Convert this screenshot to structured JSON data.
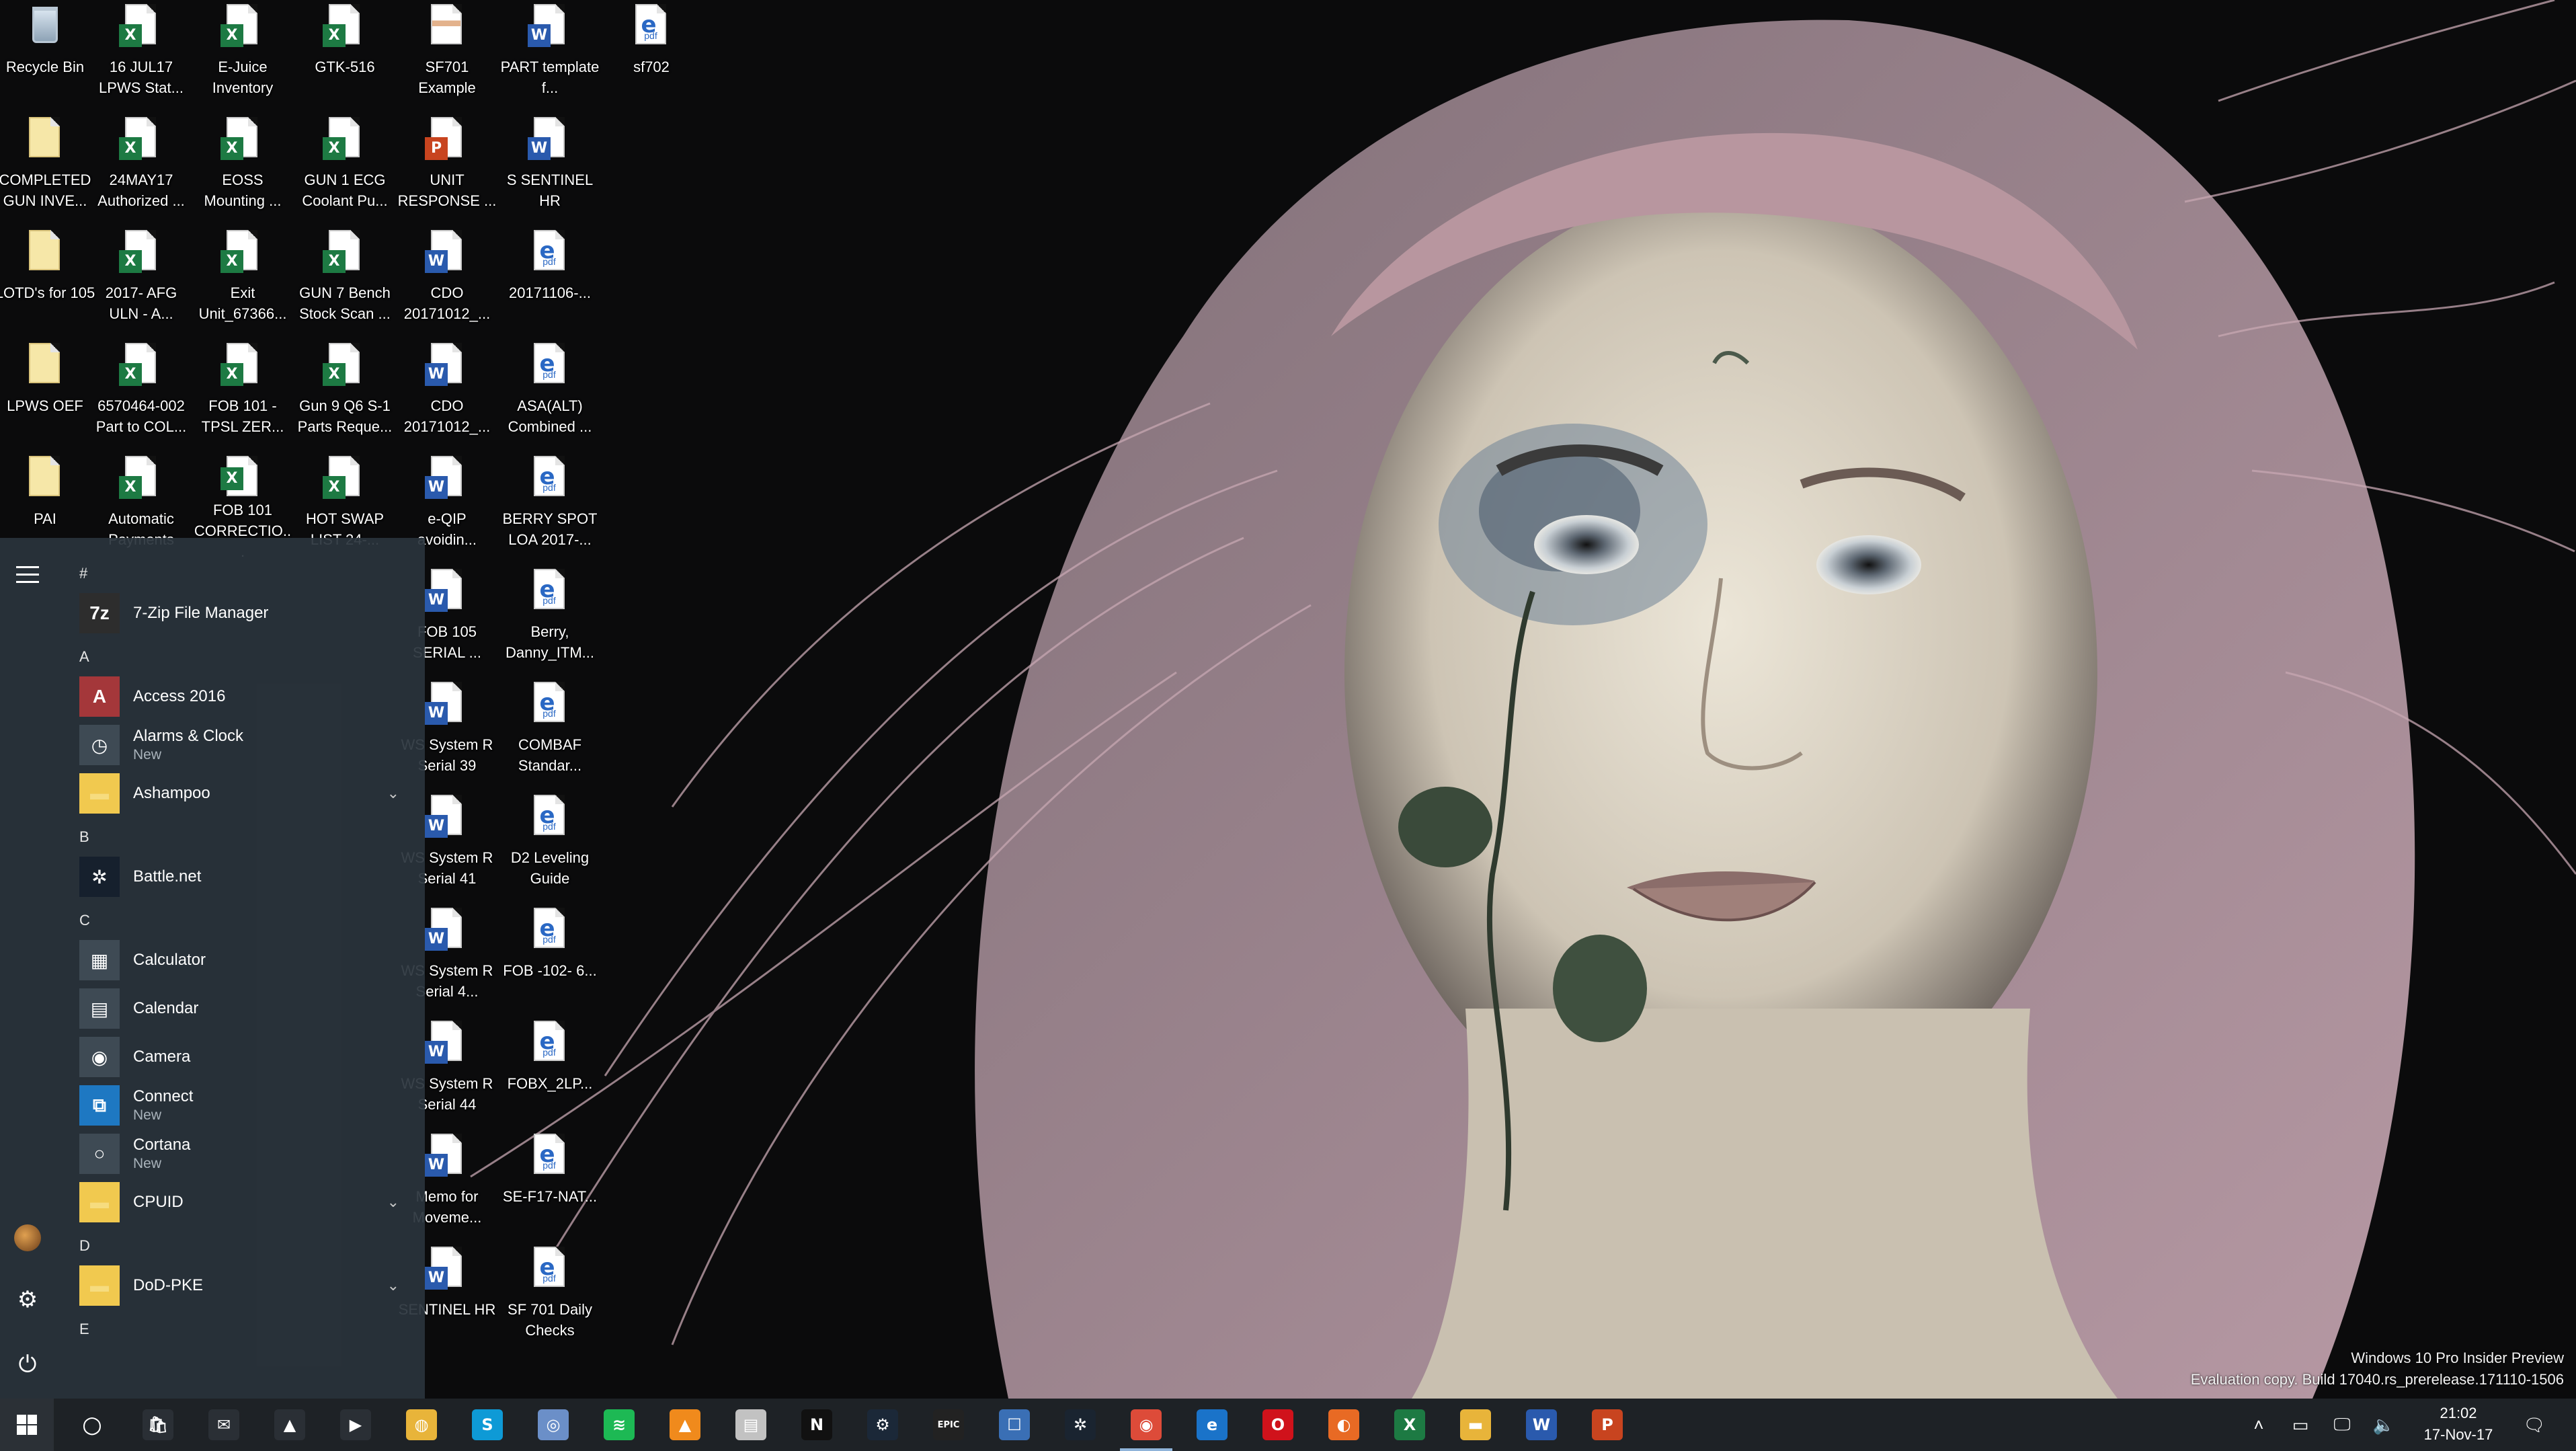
{
  "desktop": {
    "icons": [
      {
        "label": "Recycle Bin",
        "kind": "recycle"
      },
      {
        "label": "16 JUL17 LPWS Stat...",
        "kind": "excel"
      },
      {
        "label": "E-Juice Inventory",
        "kind": "excel"
      },
      {
        "label": "GTK-516",
        "kind": "excel"
      },
      {
        "label": "SF701 Example",
        "kind": "image"
      },
      {
        "label": "PART template f...",
        "kind": "word"
      },
      {
        "label": "sf702",
        "kind": "pdf"
      },
      {
        "label": "COMPLETED GUN INVE...",
        "kind": "folderdoc"
      },
      {
        "label": "24MAY17 Authorized ...",
        "kind": "excel"
      },
      {
        "label": "EOSS Mounting ...",
        "kind": "excel"
      },
      {
        "label": "GUN 1 ECG Coolant Pu...",
        "kind": "excel"
      },
      {
        "label": "UNIT RESPONSE ...",
        "kind": "ppt"
      },
      {
        "label": "S SENTINEL HR",
        "kind": "word"
      },
      {
        "label": "LOTD's for 105",
        "kind": "folderdoc"
      },
      {
        "label": "2017- AFG ULN - A...",
        "kind": "excel"
      },
      {
        "label": "Exit Unit_67366...",
        "kind": "excel"
      },
      {
        "label": "GUN 7 Bench Stock Scan ...",
        "kind": "excel"
      },
      {
        "label": "CDO 20171012_...",
        "kind": "word"
      },
      {
        "label": "20171106-...",
        "kind": "pdf"
      },
      {
        "label": "LPWS OEF",
        "kind": "folderdoc"
      },
      {
        "label": "6570464-002 Part to COL...",
        "kind": "excel"
      },
      {
        "label": "FOB 101 - TPSL ZER...",
        "kind": "excel"
      },
      {
        "label": "Gun 9 Q6 S-1 Parts Reque...",
        "kind": "excel"
      },
      {
        "label": "CDO 20171012_...",
        "kind": "word"
      },
      {
        "label": "ASA(ALT) Combined ...",
        "kind": "pdf"
      },
      {
        "label": "PAI",
        "kind": "folderdoc"
      },
      {
        "label": "Automatic Payments",
        "kind": "excel"
      },
      {
        "label": "FOB 101 CORRECTIO...",
        "kind": "excel"
      },
      {
        "label": "HOT SWAP LIST 24-...",
        "kind": "excel"
      },
      {
        "label": "e-QIP avoidin...",
        "kind": "word"
      },
      {
        "label": "BERRY SPOT LOA 2017-...",
        "kind": "pdf"
      },
      {
        "label": "FOB 105 SERIAL ...",
        "kind": "word"
      },
      {
        "label": "Berry, Danny_ITM...",
        "kind": "pdf"
      },
      {
        "label": "WS System R Serial 39",
        "kind": "word"
      },
      {
        "label": "COMBAF Standar...",
        "kind": "pdf"
      },
      {
        "label": "WS System R Serial 41",
        "kind": "word"
      },
      {
        "label": "D2 Leveling Guide",
        "kind": "pdf"
      },
      {
        "label": "WS System R Serial 4...",
        "kind": "word"
      },
      {
        "label": "FOB -102- 6...",
        "kind": "pdf"
      },
      {
        "label": "WS System R Serial 44",
        "kind": "word"
      },
      {
        "label": "FOBX_2LP...",
        "kind": "pdf"
      },
      {
        "label": "Memo for Moveme...",
        "kind": "word"
      },
      {
        "label": "SE-F17-NAT...",
        "kind": "pdf"
      },
      {
        "label": "SENTINEL HR",
        "kind": "word"
      },
      {
        "label": "SF 701 Daily Checks",
        "kind": "pdf"
      }
    ]
  },
  "start_menu": {
    "sections": [
      {
        "letter": "#",
        "apps": [
          {
            "name": "7-Zip File Manager",
            "sub": "",
            "tile": "7z",
            "color": "#2d2d2d",
            "expand": false
          }
        ]
      },
      {
        "letter": "A",
        "apps": [
          {
            "name": "Access 2016",
            "sub": "",
            "tile": "A",
            "color": "#a4373a",
            "expand": false
          },
          {
            "name": "Alarms & Clock",
            "sub": "New",
            "tile": "◷",
            "color": "#3e4a54",
            "expand": false
          },
          {
            "name": "Ashampoo",
            "sub": "",
            "tile": "▬",
            "color": "#f1c94f",
            "expand": true
          }
        ]
      },
      {
        "letter": "B",
        "apps": [
          {
            "name": "Battle.net",
            "sub": "",
            "tile": "✲",
            "color": "#16202d",
            "expand": false
          }
        ]
      },
      {
        "letter": "C",
        "apps": [
          {
            "name": "Calculator",
            "sub": "",
            "tile": "▦",
            "color": "#3e4a54",
            "expand": false
          },
          {
            "name": "Calendar",
            "sub": "",
            "tile": "▤",
            "color": "#3e4a54",
            "expand": false
          },
          {
            "name": "Camera",
            "sub": "",
            "tile": "◉",
            "color": "#3e4a54",
            "expand": false
          },
          {
            "name": "Connect",
            "sub": "New",
            "tile": "⧉",
            "color": "#1e78c2",
            "expand": false
          },
          {
            "name": "Cortana",
            "sub": "New",
            "tile": "○",
            "color": "#3e4a54",
            "expand": false
          },
          {
            "name": "CPUID",
            "sub": "",
            "tile": "▬",
            "color": "#f1c94f",
            "expand": true
          }
        ]
      },
      {
        "letter": "D",
        "apps": [
          {
            "name": "DoD-PKE",
            "sub": "",
            "tile": "▬",
            "color": "#f1c94f",
            "expand": true
          }
        ]
      },
      {
        "letter": "E",
        "apps": []
      }
    ]
  },
  "taskbar": {
    "apps": [
      {
        "name": "task-view",
        "glyph": "○",
        "color": "transparent"
      },
      {
        "name": "store",
        "glyph": "🛍",
        "color": "#2a2f35"
      },
      {
        "name": "mail",
        "glyph": "✉",
        "color": "#2a2f35"
      },
      {
        "name": "photos",
        "glyph": "▲",
        "color": "#2a2f35"
      },
      {
        "name": "movies",
        "glyph": "▶",
        "color": "#2a2f35"
      },
      {
        "name": "disk",
        "glyph": "◍",
        "color": "#e8b43a"
      },
      {
        "name": "skype",
        "glyph": "S",
        "color": "#0e9ad6"
      },
      {
        "name": "app-blue",
        "glyph": "◎",
        "color": "#6b8fc8"
      },
      {
        "name": "spotify",
        "glyph": "≋",
        "color": "#1db954"
      },
      {
        "name": "vlc",
        "glyph": "▲",
        "color": "#f08a1c"
      },
      {
        "name": "calendar-app",
        "glyph": "▤",
        "color": "#c2c2c2"
      },
      {
        "name": "netflix",
        "glyph": "N",
        "color": "#111111"
      },
      {
        "name": "steam",
        "glyph": "⚙",
        "color": "#1b2838"
      },
      {
        "name": "epic-games",
        "glyph": "EPIC",
        "color": "#222222"
      },
      {
        "name": "outlook-app",
        "glyph": "☐",
        "color": "#3a6fb5"
      },
      {
        "name": "battlenet",
        "glyph": "✲",
        "color": "#1a2430"
      },
      {
        "name": "chrome",
        "glyph": "◉",
        "color": "#dd4b39"
      },
      {
        "name": "edge",
        "glyph": "e",
        "color": "#1a73c9"
      },
      {
        "name": "opera",
        "glyph": "O",
        "color": "#d0121b"
      },
      {
        "name": "firefox",
        "glyph": "◐",
        "color": "#e86a24"
      },
      {
        "name": "excel",
        "glyph": "X",
        "color": "#1d7a43"
      },
      {
        "name": "file-explorer",
        "glyph": "▬",
        "color": "#e8b43a"
      },
      {
        "name": "word",
        "glyph": "W",
        "color": "#2a5aad"
      },
      {
        "name": "powerpoint",
        "glyph": "P",
        "color": "#c8441f"
      }
    ],
    "clock_time": "21:02",
    "clock_date": "17-Nov-17"
  },
  "watermark": {
    "line1": "Windows 10 Pro Insider Preview",
    "line2": "Evaluation copy. Build 17040.rs_prerelease.171110-1506"
  }
}
